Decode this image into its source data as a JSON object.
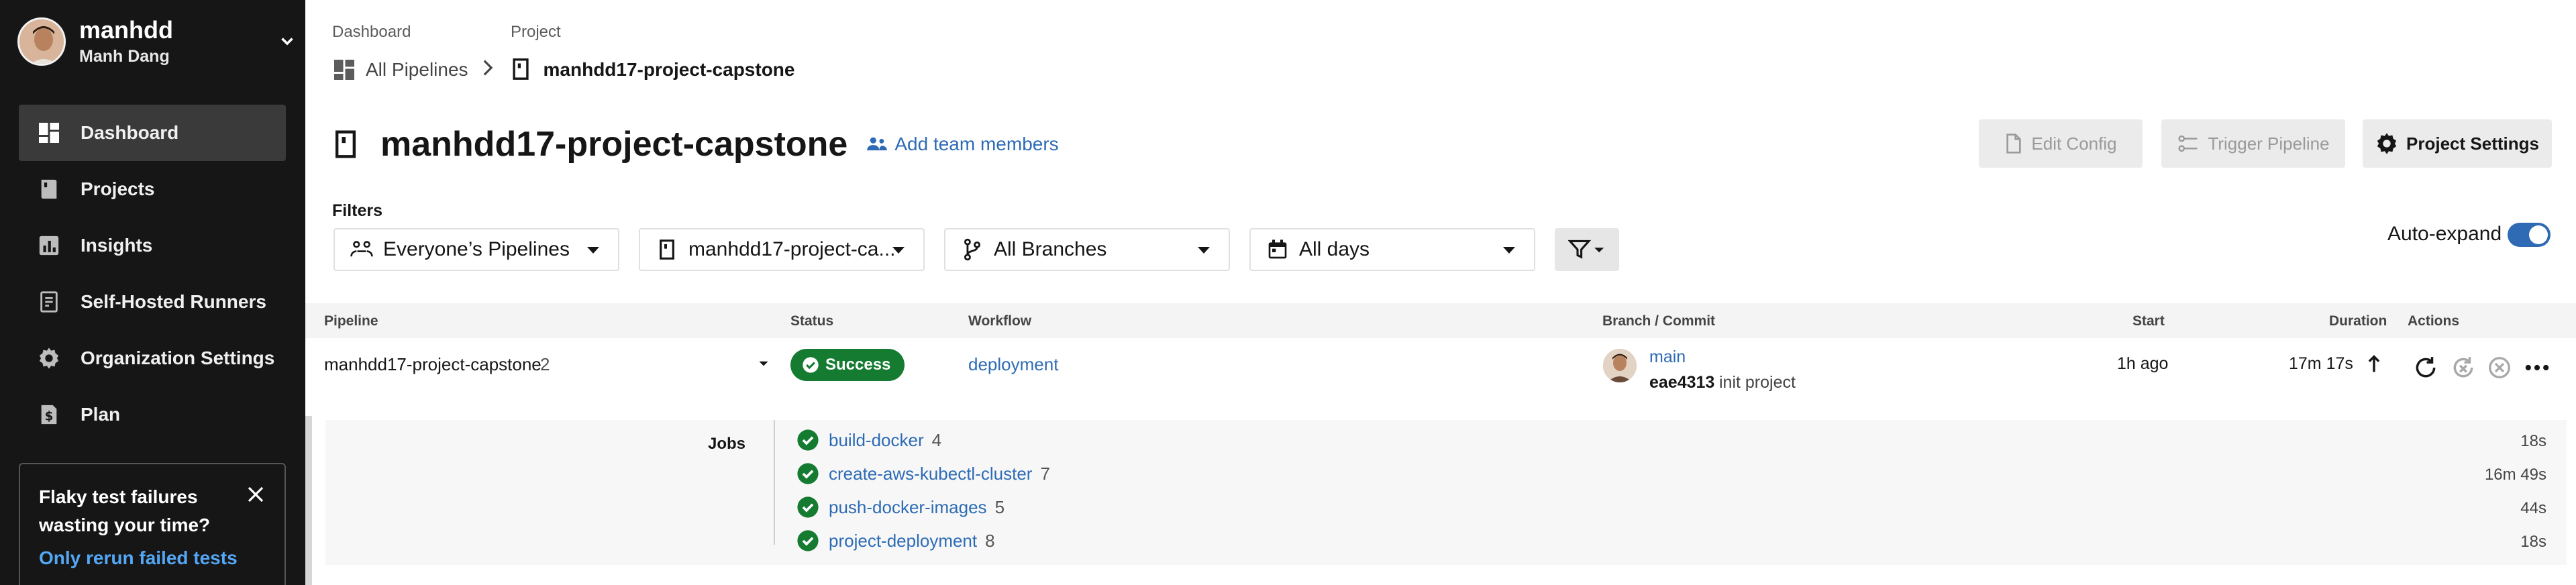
{
  "user": {
    "username": "manhdd",
    "full_name": "Manh Dang"
  },
  "nav": [
    {
      "label": "Dashboard",
      "icon": "dashboard-icon",
      "active": true
    },
    {
      "label": "Projects",
      "icon": "book-icon"
    },
    {
      "label": "Insights",
      "icon": "chart-icon"
    },
    {
      "label": "Self-Hosted Runners",
      "icon": "runner-icon"
    },
    {
      "label": "Organization Settings",
      "icon": "gear-icon"
    },
    {
      "label": "Plan",
      "icon": "dollar-icon"
    }
  ],
  "promo": {
    "title": "Flaky test failures wasting your time?",
    "link": "Only rerun failed tests"
  },
  "breadcrumb": {
    "label_dashboard": "Dashboard",
    "label_project": "Project",
    "all_pipelines": "All Pipelines",
    "project": "manhdd17-project-capstone"
  },
  "header": {
    "title": "manhdd17-project-capstone",
    "add_team": "Add team members",
    "edit_config": "Edit Config",
    "trigger_pipeline": "Trigger Pipeline",
    "project_settings": "Project Settings"
  },
  "filters": {
    "label": "Filters",
    "pipelines": "Everyone’s Pipelines",
    "project": "manhdd17-project-ca...",
    "branches": "All Branches",
    "days": "All days",
    "auto_expand": "Auto-expand",
    "auto_expand_on": true
  },
  "table": {
    "headers": {
      "pipeline": "Pipeline",
      "status": "Status",
      "workflow": "Workflow",
      "branch_commit": "Branch / Commit",
      "start": "Start",
      "duration": "Duration",
      "actions": "Actions"
    },
    "row": {
      "pipeline": "manhdd17-project-capstone",
      "number": "2",
      "status": "Success",
      "workflow": "deployment",
      "branch": "main",
      "commit_hash": "eae4313",
      "commit_msg": "init project",
      "start": "1h ago",
      "duration": "17m 17s"
    },
    "jobs_label": "Jobs",
    "jobs": [
      {
        "name": "build-docker",
        "number": "4",
        "duration": "18s"
      },
      {
        "name": "create-aws-kubectl-cluster",
        "number": "7",
        "duration": "16m 49s"
      },
      {
        "name": "push-docker-images",
        "number": "5",
        "duration": "44s"
      },
      {
        "name": "project-deployment",
        "number": "8",
        "duration": "18s"
      }
    ]
  },
  "colors": {
    "success": "#157b31",
    "link": "#2d6bb5",
    "sidebar": "#161616",
    "toggle": "#2f6ab4"
  }
}
